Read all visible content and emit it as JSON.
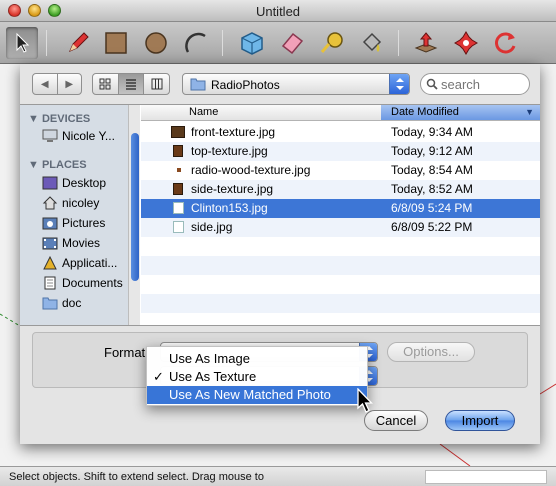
{
  "window": {
    "title": "Untitled"
  },
  "toolbar": {
    "tools": [
      {
        "name": "select-tool",
        "icon": "arrow-cursor-icon"
      },
      {
        "name": "pencil-tool",
        "icon": "pencil-icon"
      },
      {
        "name": "rectangle-tool",
        "icon": "rectangle-icon"
      },
      {
        "name": "circle-tool",
        "icon": "circle-icon"
      },
      {
        "name": "arc-tool",
        "icon": "arc-icon"
      },
      {
        "name": "make-component-tool",
        "icon": "component-icon"
      },
      {
        "name": "eraser-tool",
        "icon": "eraser-icon"
      },
      {
        "name": "tape-measure-tool",
        "icon": "tape-measure-icon"
      },
      {
        "name": "paint-bucket-tool",
        "icon": "paint-bucket-icon"
      },
      {
        "name": "push-pull-tool",
        "icon": "push-pull-icon"
      },
      {
        "name": "move-tool",
        "icon": "move-icon"
      },
      {
        "name": "rotate-tool",
        "icon": "rotate-icon"
      }
    ]
  },
  "dialog": {
    "path": "RadioPhotos",
    "search_placeholder": "search",
    "sidebar": {
      "devices_heading": "DEVICES",
      "device_items": [
        "Nicole Y..."
      ],
      "places_heading": "PLACES",
      "place_items": [
        "Desktop",
        "nicoley",
        "Pictures",
        "Movies",
        "Applicati...",
        "Documents",
        "doc"
      ]
    },
    "columns": {
      "name": "Name",
      "date": "Date Modified"
    },
    "files": [
      {
        "name": "front-texture.jpg",
        "date": "Today, 9:34 AM"
      },
      {
        "name": "top-texture.jpg",
        "date": "Today, 9:12 AM"
      },
      {
        "name": "radio-wood-texture.jpg",
        "date": "Today, 8:54 AM"
      },
      {
        "name": "side-texture.jpg",
        "date": "Today, 8:52 AM"
      },
      {
        "name": "Clinton153.jpg",
        "date": "6/8/09 5:24 PM"
      },
      {
        "name": "side.jpg",
        "date": "6/8/09 5:22 PM"
      }
    ],
    "format_label": "Format",
    "options_label": "Options...",
    "cancel_label": "Cancel",
    "import_label": "Import"
  },
  "menu": {
    "items": [
      {
        "label": "Use As Image",
        "checked": ""
      },
      {
        "label": "Use As Texture",
        "checked": "✓"
      },
      {
        "label": "Use As New Matched Photo",
        "checked": ""
      }
    ]
  },
  "status": {
    "text": "Select objects. Shift to extend select. Drag mouse to"
  },
  "colors": {
    "selection": "#3d76d6",
    "accent": "#3875d7"
  }
}
